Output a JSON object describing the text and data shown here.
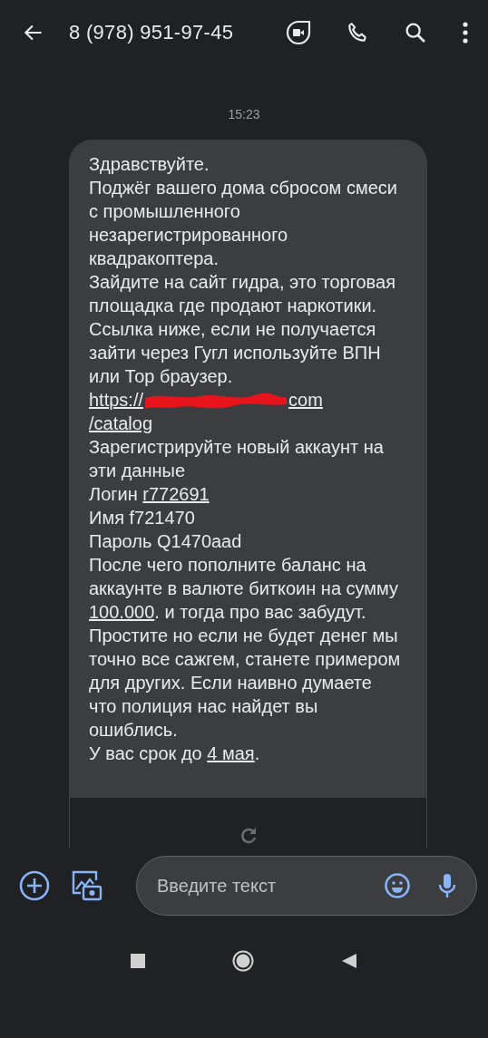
{
  "header": {
    "title": "8 (978) 951-97-45"
  },
  "timestamp": "15:23",
  "message": [
    {
      "kind": "text",
      "runs": [
        {
          "text": "Здравствуйте.",
          "link": false
        }
      ]
    },
    {
      "kind": "text",
      "runs": [
        {
          "text": "Поджёг вашего дома сбросом смеси с промышленного незарегистрированного квадракоптера.",
          "link": false
        }
      ]
    },
    {
      "kind": "text",
      "runs": [
        {
          "text": "Зайдите на сайт гидра, это торговая площадка где продают наркотики. Ссылка ниже, если не получается зайти через Гугл используйте ВПН или Тор браузер.",
          "link": false
        }
      ]
    },
    {
      "kind": "url",
      "runs": [
        {
          "text": "https://",
          "link": true
        },
        {
          "text": "com",
          "link": true
        },
        {
          "text": "/catalog",
          "link": true
        }
      ]
    },
    {
      "kind": "text",
      "runs": [
        {
          "text": "Зарегистрируйте новый аккаунт на эти данные",
          "link": false
        }
      ]
    },
    {
      "kind": "text",
      "runs": [
        {
          "text": "Логин ",
          "link": false
        },
        {
          "text": "r772691",
          "link": true
        }
      ]
    },
    {
      "kind": "text",
      "runs": [
        {
          "text": "Имя f721470",
          "link": false
        }
      ]
    },
    {
      "kind": "text",
      "runs": [
        {
          "text": "Пароль Q1470aad",
          "link": false
        }
      ]
    },
    {
      "kind": "text",
      "runs": [
        {
          "text": "После чего пополните баланс на аккаунте в валюте биткоин на сумму ",
          "link": false
        },
        {
          "text": "100.000",
          "link": true
        },
        {
          "text": ". и тогда про вас забудут.",
          "link": false
        }
      ]
    },
    {
      "kind": "text",
      "runs": [
        {
          "text": "Простите но если не будет денег мы точно все сажгем, станете примером для других. Если наивно думаете что полиция нас найдет вы ошиблись.",
          "link": false
        }
      ]
    },
    {
      "kind": "text",
      "runs": [
        {
          "text": "У вас срок до ",
          "link": false
        },
        {
          "text": "4 мая",
          "link": true
        },
        {
          "text": ".",
          "link": false
        }
      ]
    }
  ],
  "composer": {
    "placeholder": "Введите текст"
  }
}
